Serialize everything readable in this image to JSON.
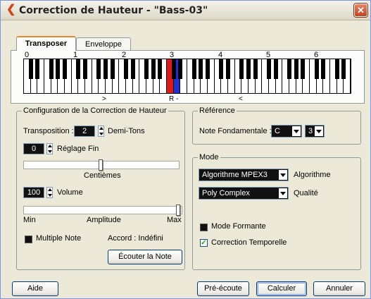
{
  "window": {
    "title": "Correction de Hauteur - \"Bass-03\"",
    "title_icon": "cubase-logo-icon",
    "close_icon": "close-icon",
    "close_glyph": "✕"
  },
  "tabs": [
    {
      "label": "Transposer",
      "active": true
    },
    {
      "label": "Enveloppe",
      "active": false
    }
  ],
  "keyboard": {
    "octave_labels": [
      "0",
      "1",
      "2",
      "3",
      "4",
      "5",
      "6"
    ],
    "markers": {
      "left": ">",
      "root": "R -",
      "right": "<"
    },
    "highlight_colors": {
      "red": "#e01818",
      "blue": "#2030d0"
    }
  },
  "pitch_config": {
    "title": "Configuration de la Correction de Hauteur",
    "transposition_label": "Transposition :",
    "transposition_value": "2",
    "transposition_unit": "Demi-Tons",
    "fine_value": "0",
    "fine_label": "Réglage Fin",
    "fine_slider_label": "Centièmes",
    "fine_slider_level": 0.5,
    "volume_value": "100",
    "volume_label": "Volume",
    "amp_min": "Min",
    "amp_label": "Amplitude",
    "amp_max": "Max",
    "amp_slider_level": 1.0,
    "multiple_note_label": "Multiple Note",
    "multiple_note_checked": false,
    "chord_text": "Accord : Indéfini",
    "listen_button": "Écouter la Note"
  },
  "reference": {
    "title": "Référence",
    "root_label": "Note Fondamentale :",
    "root_note": "C",
    "root_octave": "3"
  },
  "mode": {
    "title": "Mode",
    "algorithm_value": "Algorithme MPEX3",
    "algorithm_label": "Algorithme",
    "quality_value": "Poly Complex",
    "quality_label": "Qualité",
    "formant_label": "Mode Formante",
    "formant_checked": false,
    "time_correction_label": "Correction Temporelle",
    "time_correction_checked": true
  },
  "buttons": {
    "help": "Aide",
    "preview": "Pré-écoute",
    "calculate": "Calculer",
    "cancel": "Annuler"
  }
}
